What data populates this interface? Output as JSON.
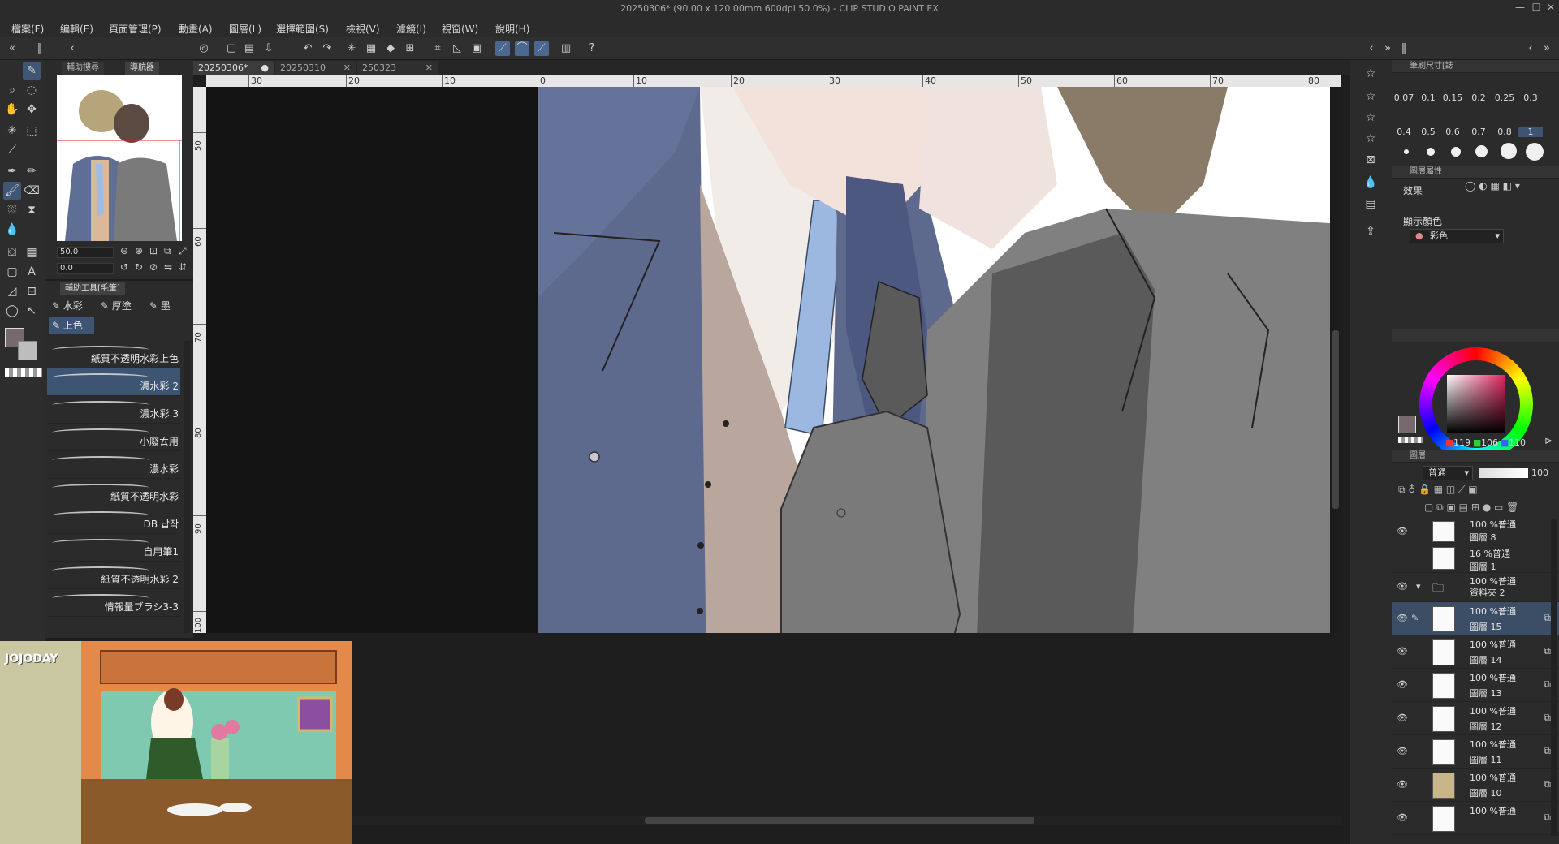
{
  "window": {
    "title": "20250306* (90.00 x 120.00mm 600dpi 50.0%) - CLIP STUDIO PAINT EX",
    "minimize": "—",
    "maximize": "☐",
    "close": "✕"
  },
  "menu": [
    "檔案(F)",
    "編輯(E)",
    "頁面管理(P)",
    "動畫(A)",
    "圖層(L)",
    "選擇範圍(S)",
    "檢視(V)",
    "濾鏡(I)",
    "視窗(W)",
    "說明(H)"
  ],
  "doc_tabs": [
    {
      "label": "20250306*",
      "active": true
    },
    {
      "label": "20250310",
      "active": false
    },
    {
      "label": "250323",
      "active": false
    }
  ],
  "navigator": {
    "tabs": [
      "輔助搜尋",
      "導航器"
    ],
    "zoom_value": "50.0",
    "rotate_value": "0.0"
  },
  "subtool": {
    "tab": "輔助工具[毛筆]",
    "groups": [
      "水彩",
      "厚塗",
      "墨",
      "上色"
    ],
    "brushes": [
      {
        "name": "紙質不透明水彩上色",
        "selected": false
      },
      {
        "name": "濃水彩 2",
        "selected": true
      },
      {
        "name": "濃水彩 3",
        "selected": false
      },
      {
        "name": "小廢ㄊ用",
        "selected": false
      },
      {
        "name": "濃水彩",
        "selected": false
      },
      {
        "name": "紙質不透明水彩",
        "selected": false
      },
      {
        "name": "DB 납작",
        "selected": false
      },
      {
        "name": "自用筆1",
        "selected": false
      },
      {
        "name": "紙質不透明水彩 2",
        "selected": false
      },
      {
        "name": "情報量ブラシ3-3",
        "selected": false
      }
    ]
  },
  "ruler_h": [
    "30",
    "20",
    "10",
    "0",
    "10",
    "20",
    "30",
    "40",
    "50",
    "60",
    "70",
    "80"
  ],
  "ruler_v": [
    "50",
    "60",
    "70",
    "80",
    "90",
    "100"
  ],
  "brush_size": {
    "tab": "筆刷尺寸[誌",
    "row1": [
      "0.07",
      "0.1",
      "0.15",
      "0.2",
      "0.25",
      "0.3"
    ],
    "row2": [
      "0.4",
      "0.5",
      "0.6",
      "0.7",
      "0.8",
      "1"
    ]
  },
  "layer_property": {
    "tab": "圖層屬性",
    "effect_label": "效果",
    "display_color_label": "顯示顏色",
    "display_color_value": "彩色"
  },
  "color": {
    "r": "119",
    "g": "106",
    "b": "110",
    "main_color": "#776a6e",
    "sub_color": "#bdbdbd"
  },
  "layers_panel": {
    "tab": "圖層",
    "blend_mode": "普通",
    "opacity": "100",
    "rows": [
      {
        "mode": "100 %普通",
        "name": "圖層 8",
        "selected": false,
        "folder": false
      },
      {
        "mode": "16 %普通",
        "name": "圖層 1",
        "selected": false,
        "folder": false
      },
      {
        "mode": "100 %普通",
        "name": "資料夾 2",
        "selected": false,
        "folder": true
      },
      {
        "mode": "100 %普通",
        "name": "圖層 15",
        "selected": true,
        "folder": false
      },
      {
        "mode": "100 %普通",
        "name": "圖層 14",
        "selected": false,
        "folder": false
      },
      {
        "mode": "100 %普通",
        "name": "圖層 13",
        "selected": false,
        "folder": false
      },
      {
        "mode": "100 %普通",
        "name": "圖層 12",
        "selected": false,
        "folder": false
      },
      {
        "mode": "100 %普通",
        "name": "圖層 11",
        "selected": false,
        "folder": false
      },
      {
        "mode": "100 %普通",
        "name": "圖層 10",
        "selected": false,
        "folder": false
      },
      {
        "mode": "100 %普通",
        "name": "",
        "selected": false,
        "folder": false
      }
    ]
  },
  "overlay": {
    "logo": "JOJODAY"
  }
}
